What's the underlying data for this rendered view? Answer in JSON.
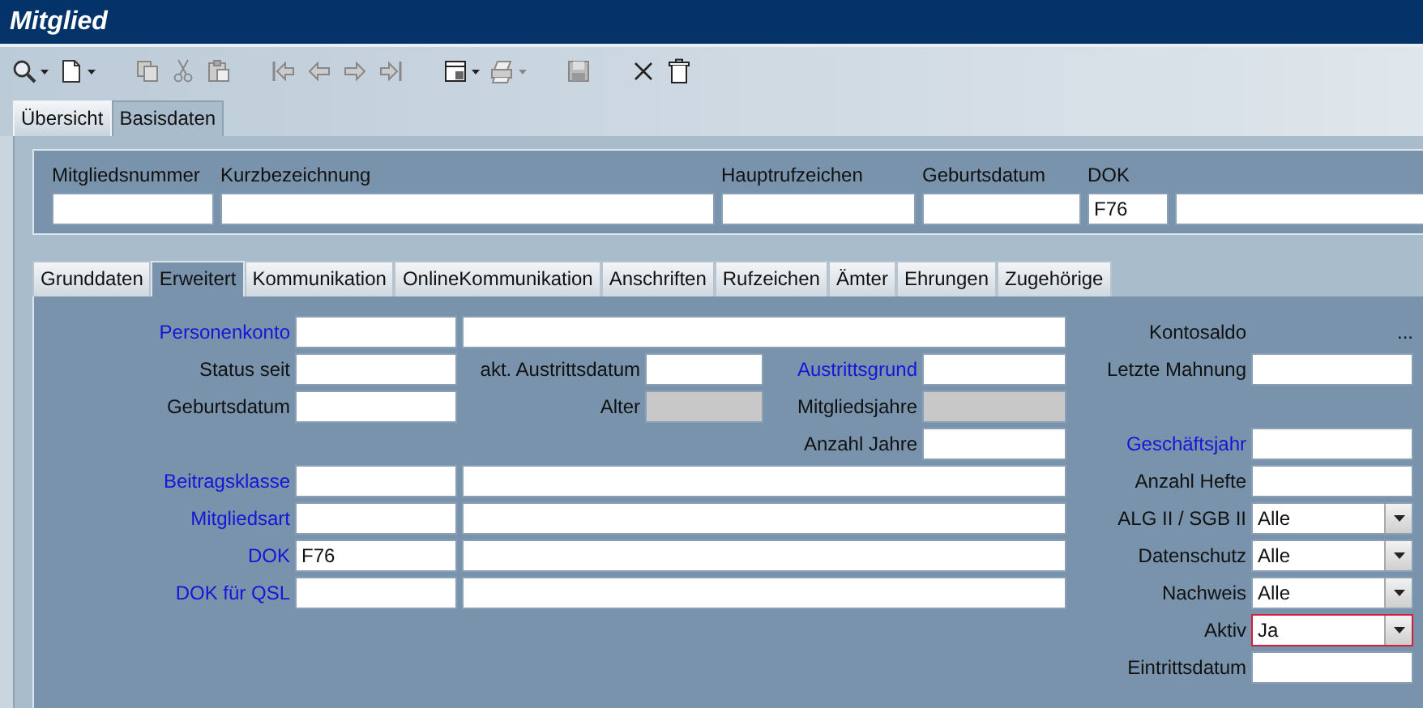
{
  "window": {
    "title": "Mitglied"
  },
  "toolbar": [
    [
      {
        "kind": "search",
        "dropdown": true,
        "disabled": false
      },
      {
        "kind": "new",
        "dropdown": true,
        "disabled": false
      }
    ],
    [
      {
        "kind": "copy",
        "dropdown": false,
        "disabled": true
      },
      {
        "kind": "cut",
        "dropdown": false,
        "disabled": true
      },
      {
        "kind": "paste",
        "dropdown": false,
        "disabled": true
      }
    ],
    [
      {
        "kind": "first",
        "dropdown": false,
        "disabled": true
      },
      {
        "kind": "prev",
        "dropdown": false,
        "disabled": true
      },
      {
        "kind": "next",
        "dropdown": false,
        "disabled": true
      },
      {
        "kind": "last",
        "dropdown": false,
        "disabled": true
      }
    ],
    [
      {
        "kind": "layout",
        "dropdown": true,
        "disabled": false
      },
      {
        "kind": "print",
        "dropdown": true,
        "disabled": true
      }
    ],
    [
      {
        "kind": "save",
        "dropdown": false,
        "disabled": true
      }
    ],
    [
      {
        "kind": "cancel",
        "dropdown": false,
        "disabled": false
      },
      {
        "kind": "delete",
        "dropdown": false,
        "disabled": false
      }
    ]
  ],
  "main_tabs": [
    {
      "label": "Übersicht",
      "selected": false
    },
    {
      "label": "Basisdaten",
      "selected": true
    }
  ],
  "header_fields": [
    {
      "kind": "input",
      "label": "Mitgliedsnummer"
    },
    {
      "kind": "input",
      "label": "Kurzbezeichnung"
    },
    {
      "kind": "input",
      "label": "Hauptrufzeichen"
    },
    {
      "kind": "input",
      "label": "Geburtsdatum"
    },
    {
      "kind": "input",
      "label": "DOK",
      "value": "F76"
    },
    {
      "kind": "input"
    }
  ],
  "detail_tabs": [
    {
      "label": "Grunddaten",
      "selected": false
    },
    {
      "label": "Erweitert",
      "selected": true
    },
    {
      "label": "Kommunikation",
      "selected": false
    },
    {
      "label": "OnlineKommunikation",
      "selected": false
    },
    {
      "label": "Anschriften",
      "selected": false
    },
    {
      "label": "Rufzeichen",
      "selected": false
    },
    {
      "label": "Ämter",
      "selected": false
    },
    {
      "label": "Ehrungen",
      "selected": false
    },
    {
      "label": "Zugehörige",
      "selected": false
    }
  ],
  "rows": [
    {
      "cells": [
        {
          "kind": "label",
          "text": "Personenkonto",
          "link": true
        },
        {
          "kind": "input",
          "disabled": false
        },
        {
          "kind": "input",
          "disabled": false
        },
        {
          "kind": "label",
          "text": "Kontosaldo",
          "link": false
        },
        {
          "kind": "text",
          "text": "..."
        }
      ]
    },
    {
      "cells": [
        {
          "kind": "label",
          "text": "Status seit",
          "link": false
        },
        {
          "kind": "input",
          "disabled": false
        },
        {
          "kind": "label",
          "text": "akt. Austrittsdatum",
          "link": false
        },
        {
          "kind": "input",
          "disabled": false
        },
        {
          "kind": "label",
          "text": "Austrittsgrund",
          "link": true
        },
        {
          "kind": "input",
          "disabled": false
        },
        {
          "kind": "label",
          "text": "Letzte Mahnung",
          "link": false
        },
        {
          "kind": "input",
          "disabled": false
        }
      ]
    },
    {
      "cells": [
        {
          "kind": "label",
          "text": "Geburtsdatum",
          "link": false
        },
        {
          "kind": "input",
          "disabled": false
        },
        {
          "kind": "label",
          "text": "Alter",
          "link": false
        },
        {
          "kind": "input",
          "disabled": true
        },
        {
          "kind": "label",
          "text": "Mitgliedsjahre",
          "link": false
        },
        {
          "kind": "input",
          "disabled": true
        }
      ]
    },
    {
      "cells": [
        {
          "kind": "label",
          "text": "Anzahl Jahre",
          "link": false
        },
        {
          "kind": "input",
          "disabled": false
        },
        {
          "kind": "label",
          "text": "Geschäftsjahr",
          "link": true
        },
        {
          "kind": "input",
          "disabled": false
        }
      ]
    },
    {
      "cells": [
        {
          "kind": "label",
          "text": "Beitragsklasse",
          "link": true
        },
        {
          "kind": "input",
          "disabled": false
        },
        {
          "kind": "input",
          "disabled": false
        },
        {
          "kind": "label",
          "text": "Anzahl Hefte",
          "link": false
        },
        {
          "kind": "input",
          "disabled": false
        }
      ]
    },
    {
      "cells": [
        {
          "kind": "label",
          "text": "Mitgliedsart",
          "link": true
        },
        {
          "kind": "input",
          "disabled": false
        },
        {
          "kind": "input",
          "disabled": false
        },
        {
          "kind": "label",
          "text": "ALG II / SGB II",
          "link": false
        },
        {
          "kind": "select",
          "value": "Alle",
          "focused": false
        }
      ]
    },
    {
      "cells": [
        {
          "kind": "label",
          "text": "DOK",
          "link": true
        },
        {
          "kind": "input",
          "value": "F76",
          "disabled": false
        },
        {
          "kind": "input",
          "disabled": false
        },
        {
          "kind": "label",
          "text": "Datenschutz",
          "link": false
        },
        {
          "kind": "select",
          "value": "Alle",
          "focused": false
        }
      ]
    },
    {
      "cells": [
        {
          "kind": "label",
          "text": "DOK für QSL",
          "link": true
        },
        {
          "kind": "input",
          "disabled": false
        },
        {
          "kind": "input",
          "disabled": false
        },
        {
          "kind": "label",
          "text": "Nachweis",
          "link": false
        },
        {
          "kind": "select",
          "value": "Alle",
          "focused": false
        }
      ]
    },
    {
      "cells": [
        {
          "kind": "label",
          "text": "Aktiv",
          "link": false
        },
        {
          "kind": "select",
          "value": "Ja",
          "focused": true
        }
      ]
    },
    {
      "cells": [
        {
          "kind": "label",
          "text": "Eintrittsdatum",
          "link": false
        },
        {
          "kind": "input",
          "disabled": false
        }
      ]
    }
  ]
}
